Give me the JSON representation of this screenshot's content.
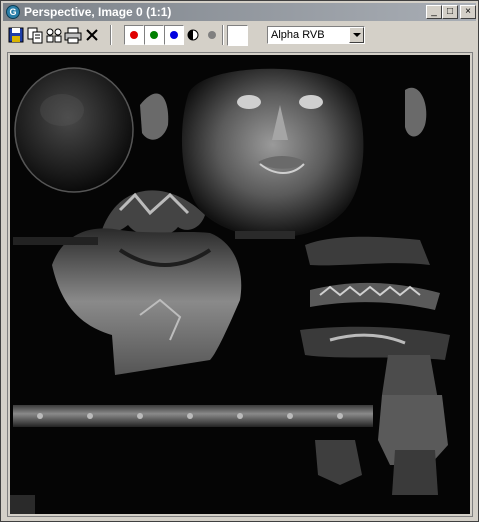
{
  "window": {
    "title": "Perspective, Image 0 (1:1)"
  },
  "title_buttons": {
    "minimize": "_",
    "maximize": "□",
    "close": "×"
  },
  "toolbar": {
    "tools": [
      "save-icon",
      "copy-icon",
      "clone-icon",
      "print-icon",
      "clear-icon"
    ],
    "channels": {
      "red_color": "#e00000",
      "green_color": "#008000",
      "blue_color": "#0000e0"
    },
    "channel_select": {
      "value": "Alpha RVB"
    }
  }
}
